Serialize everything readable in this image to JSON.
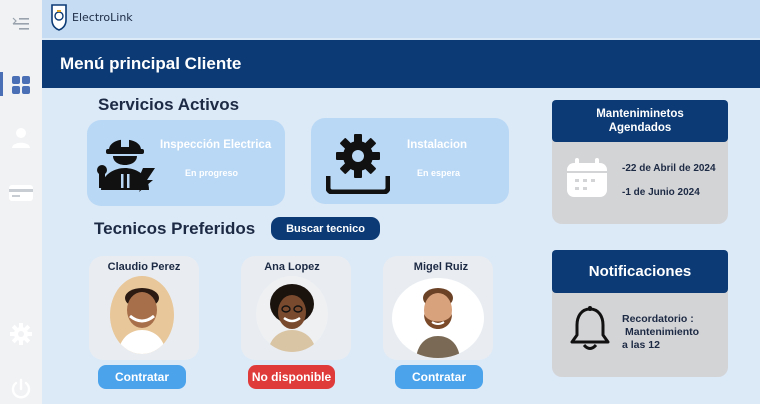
{
  "app": {
    "brand": "ElectroLink",
    "page_title": "Menú principal Cliente"
  },
  "sidebar": {
    "items": [
      {
        "name": "menu",
        "icon": "collapse-menu-icon"
      },
      {
        "name": "dashboard",
        "icon": "grid-icon",
        "active": true
      },
      {
        "name": "profile",
        "icon": "user-icon"
      },
      {
        "name": "payments",
        "icon": "credit-card-icon"
      },
      {
        "name": "settings",
        "icon": "gear-icon"
      },
      {
        "name": "power",
        "icon": "power-icon"
      }
    ]
  },
  "services": {
    "title": "Servicios Activos",
    "items": [
      {
        "name": "Inspección  Electrica",
        "status": "En progreso",
        "icon": "electrician-icon"
      },
      {
        "name": "Instalacion",
        "status": "En espera",
        "icon": "gear-install-icon"
      }
    ]
  },
  "technicians": {
    "title": "Tecnicos Preferidos",
    "search_label": "Buscar tecnico",
    "items": [
      {
        "name": "Claudio Perez",
        "action": "Contratar",
        "available": true
      },
      {
        "name": "Ana Lopez",
        "action": "No disponible",
        "available": false
      },
      {
        "name": "Migel Ruiz",
        "action": "Contratar",
        "available": true
      }
    ]
  },
  "maintenance": {
    "title_line1": "Manteniminetos",
    "title_line2": "Agendados",
    "dates": [
      "-22 de Abril de 2024",
      "-1 de Junio 2024"
    ]
  },
  "notifications": {
    "title": "Notificaciones",
    "message_line1": "Recordatorio :",
    "message_line2": "Mantenimiento",
    "message_line3": "a las 12"
  },
  "colors": {
    "primary": "#0b3a75",
    "accent_blue": "#4ba3ec",
    "danger": "#e03b3b",
    "card_blue": "#b9d8f5",
    "background": "#dce9f7"
  }
}
